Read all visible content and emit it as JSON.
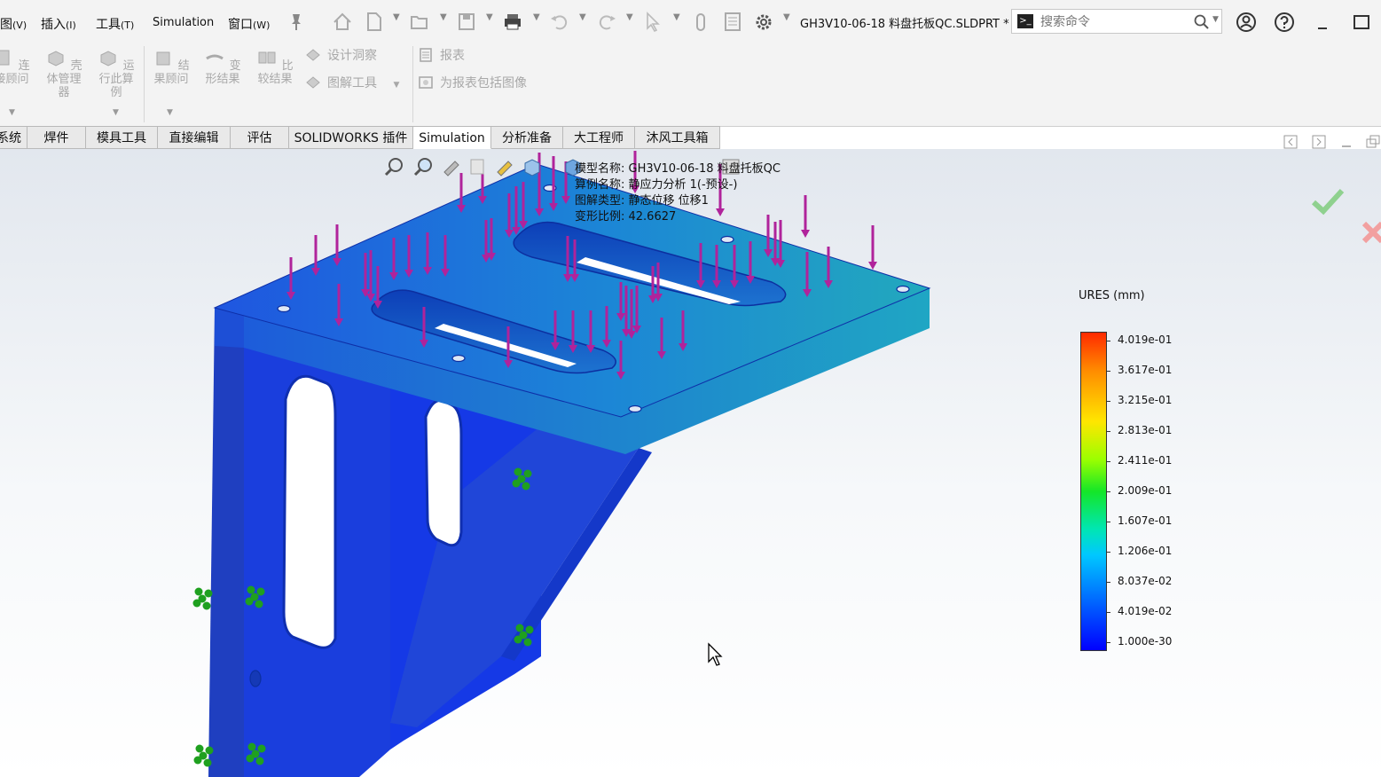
{
  "menu": {
    "items": [
      {
        "label": "图",
        "key": "(V)"
      },
      {
        "label": "插入",
        "key": "(I)"
      },
      {
        "label": "工具",
        "key": "(T)"
      },
      {
        "label": "Simulation",
        "key": ""
      },
      {
        "label": "窗口",
        "key": "(W)"
      }
    ]
  },
  "document": {
    "title": "GH3V10-06-18 料盘托板QC.SLDPRT *"
  },
  "search": {
    "placeholder": "搜索命令"
  },
  "ribbon": {
    "big_buttons": [
      {
        "label": "连接顾问"
      },
      {
        "label": "壳体管理器"
      },
      {
        "label": "运行此算例"
      },
      {
        "label": "结果顾问"
      },
      {
        "label": "变形结果"
      },
      {
        "label": "比较结果"
      }
    ],
    "small_buttons": [
      {
        "label": "设计洞察"
      },
      {
        "label": "图解工具"
      },
      {
        "label": "报表"
      },
      {
        "label": "为报表包括图像"
      }
    ]
  },
  "tabs": [
    {
      "label": "系统"
    },
    {
      "label": "焊件"
    },
    {
      "label": "模具工具"
    },
    {
      "label": "直接编辑"
    },
    {
      "label": "评估"
    },
    {
      "label": "SOLIDWORKS 插件"
    },
    {
      "label": "Simulation",
      "active": true
    },
    {
      "label": "分析准备"
    },
    {
      "label": "大工程师"
    },
    {
      "label": "沐风工具箱"
    }
  ],
  "study_info": {
    "model_name": "模型名称: GH3V10-06-18 料盘托板QC",
    "study_name": "算例名称: 静应力分析 1(-预设-)",
    "plot_type": "图解类型: 静态位移 位移1",
    "deformation_scale": "变形比例: 42.6627"
  },
  "legend": {
    "title": "URES (mm)",
    "values": [
      "4.019e-01",
      "3.617e-01",
      "3.215e-01",
      "2.813e-01",
      "2.411e-01",
      "2.009e-01",
      "1.607e-01",
      "1.206e-01",
      "8.037e-02",
      "4.019e-02",
      "1.000e-30"
    ]
  },
  "colors": {
    "load_arrow": "#b0239b",
    "fixture": "#1fa01f",
    "part_blue": "#1f46d8",
    "plate_cyan": "#22a7bd"
  }
}
